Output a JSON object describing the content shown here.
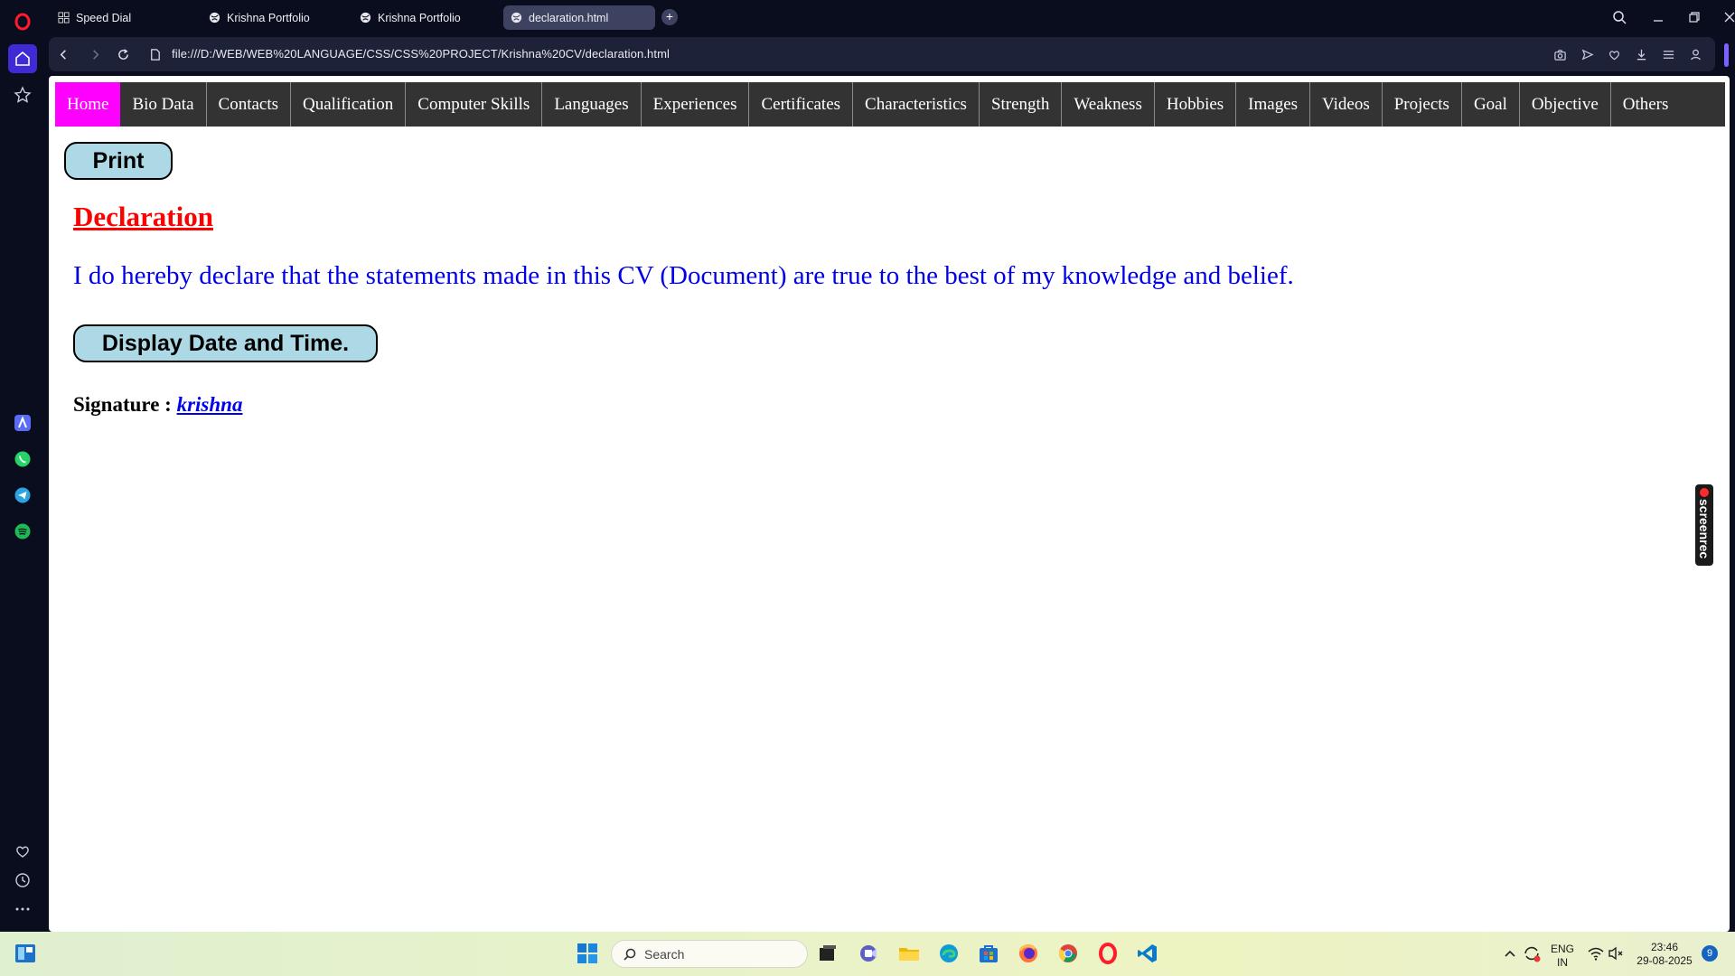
{
  "tabs": [
    {
      "label": "Speed Dial",
      "icon": "grid-icon"
    },
    {
      "label": "Krishna Portfolio",
      "icon": "globe-icon"
    },
    {
      "label": "Krishna Portfolio",
      "icon": "globe-icon"
    },
    {
      "label": "declaration.html",
      "icon": "globe-icon",
      "active": true
    }
  ],
  "address": {
    "url": "file:///D:/WEB/WEB%20LANGUAGE/CSS/CSS%20PROJECT/Krishna%20CV/declaration.html"
  },
  "nav": {
    "items": [
      "Home",
      "Bio Data",
      "Contacts",
      "Qualification",
      "Computer Skills",
      "Languages",
      "Experiences",
      "Certificates",
      "Characteristics",
      "Strength",
      "Weakness",
      "Hobbies",
      "Images",
      "Videos",
      "Projects",
      "Goal",
      "Objective",
      "Others"
    ],
    "active": "Home"
  },
  "page": {
    "print_label": "Print",
    "title": "Declaration",
    "declaration": "I do hereby declare that the statements made in this CV (Document) are true to the best of my knowledge and belief.",
    "datetime_button": "Display Date and Time.",
    "signature_label": "Signature :",
    "signature_name": "krishna"
  },
  "overlay": {
    "screenrec": "screenrec"
  },
  "taskbar": {
    "search_placeholder": "Search",
    "lang_top": "ENG",
    "lang_bottom": "IN",
    "time": "23:46",
    "date": "29-08-2025",
    "notifications": "9"
  },
  "colors": {
    "nav_bg": "#333333",
    "nav_active": "#ff00ff",
    "title": "#ff0000",
    "text": "#0000e6",
    "button_bg": "#add8e6"
  }
}
